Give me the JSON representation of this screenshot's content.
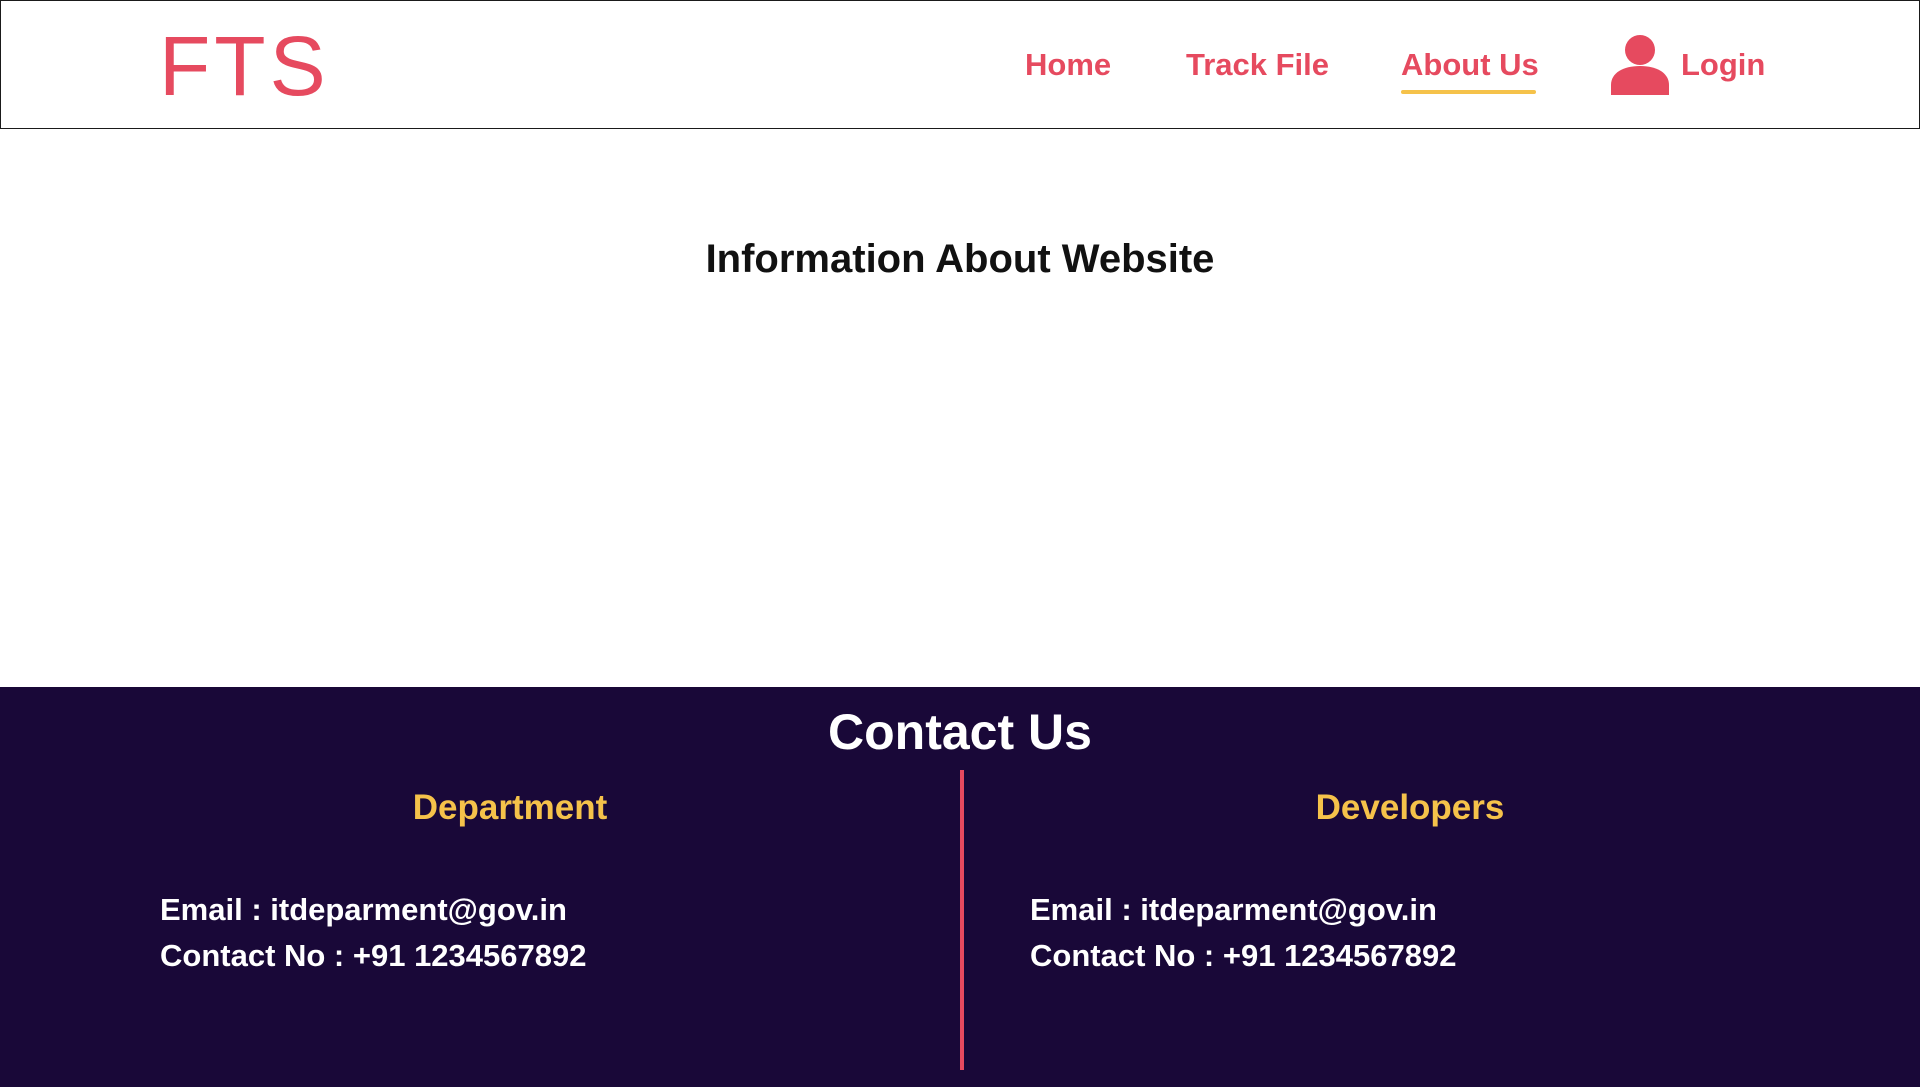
{
  "header": {
    "logo": "FTS",
    "nav": {
      "home": "Home",
      "track_file": "Track File",
      "about_us": "About Us",
      "login": "Login"
    },
    "active_tab": "About Us",
    "login_icon": "user-icon"
  },
  "main": {
    "title": "Information About Website"
  },
  "footer": {
    "title": "Contact Us",
    "department": {
      "heading": "Department",
      "email": "Email : itdeparment@gov.in",
      "contact": "Contact No : +91 1234567892"
    },
    "developers": {
      "heading": "Developers",
      "email": "Email : itdeparment@gov.in",
      "contact": "Contact No : +91 1234567892"
    }
  },
  "colors": {
    "brand": "#e64a5f",
    "accent": "#f5c24a",
    "footer_bg": "#190838"
  }
}
